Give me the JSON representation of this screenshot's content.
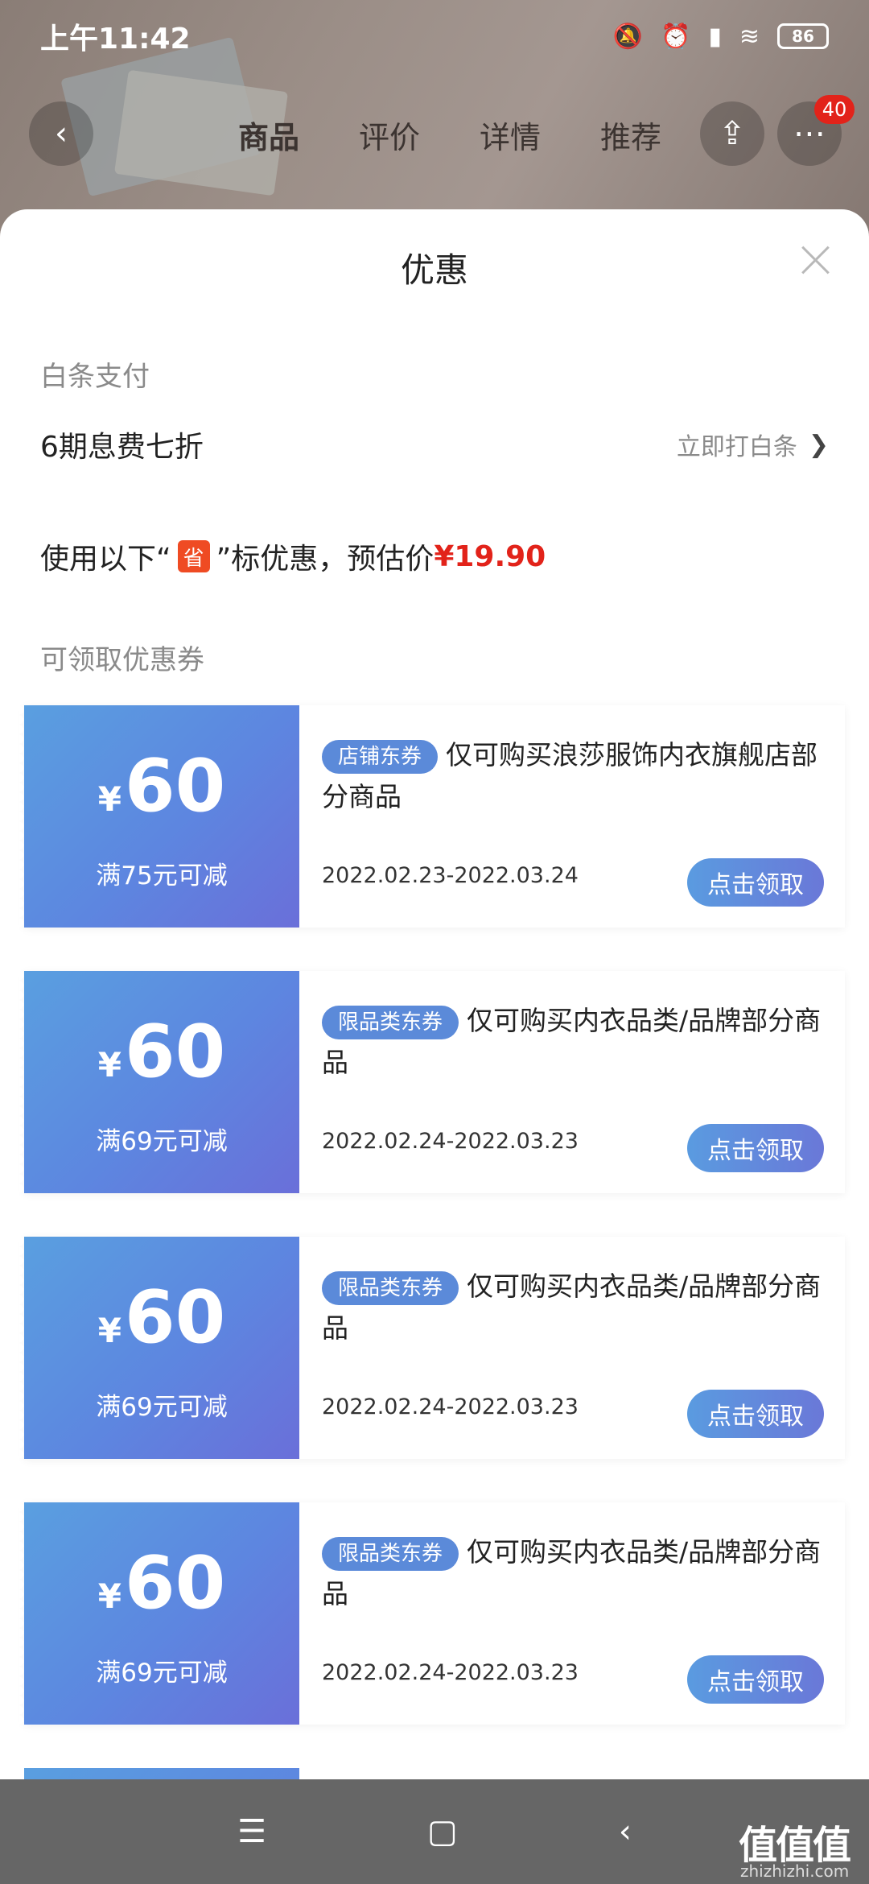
{
  "status": {
    "time": "上午11:42",
    "battery": "86",
    "icons": [
      "mute-icon",
      "alarm-icon",
      "signal-icon",
      "wifi-icon"
    ]
  },
  "nav": {
    "tabs": [
      "商品",
      "评价",
      "详情",
      "推荐"
    ],
    "active_tab": "商品",
    "badge": "40"
  },
  "sheet": {
    "title": "优惠",
    "baitiao": {
      "label": "白条支付",
      "offer": "6期息费七折",
      "action": "立即打白条"
    },
    "promo": {
      "prefix": "使用以下“",
      "icon_text": "省",
      "middle": "”标优惠，预估价",
      "price": "¥19.90"
    },
    "coupons_label": "可领取优惠券",
    "coupons": [
      {
        "yen": "¥",
        "amount": "60",
        "condition": "满75元可减",
        "tag": "店铺东券",
        "desc": "仅可购买浪莎服饰内衣旗舰店部分商品",
        "date": "2022.02.23-2022.03.24",
        "button": "点击领取"
      },
      {
        "yen": "¥",
        "amount": "60",
        "condition": "满69元可减",
        "tag": "限品类东券",
        "desc": "仅可购买内衣品类/品牌部分商品",
        "date": "2022.02.24-2022.03.23",
        "button": "点击领取"
      },
      {
        "yen": "¥",
        "amount": "60",
        "condition": "满69元可减",
        "tag": "限品类东券",
        "desc": "仅可购买内衣品类/品牌部分商品",
        "date": "2022.02.24-2022.03.23",
        "button": "点击领取"
      },
      {
        "yen": "¥",
        "amount": "60",
        "condition": "满69元可减",
        "tag": "限品类东券",
        "desc": "仅可购买内衣品类/品牌部分商品",
        "date": "2022.02.24-2022.03.23",
        "button": "点击领取"
      }
    ]
  },
  "watermark": {
    "main": "值值值",
    "sub": "zhizhizhi.com"
  },
  "colors": {
    "accent_red": "#e2231a",
    "coupon_blue": "#5d86e0",
    "tag_blue": "#5b8ad9"
  }
}
